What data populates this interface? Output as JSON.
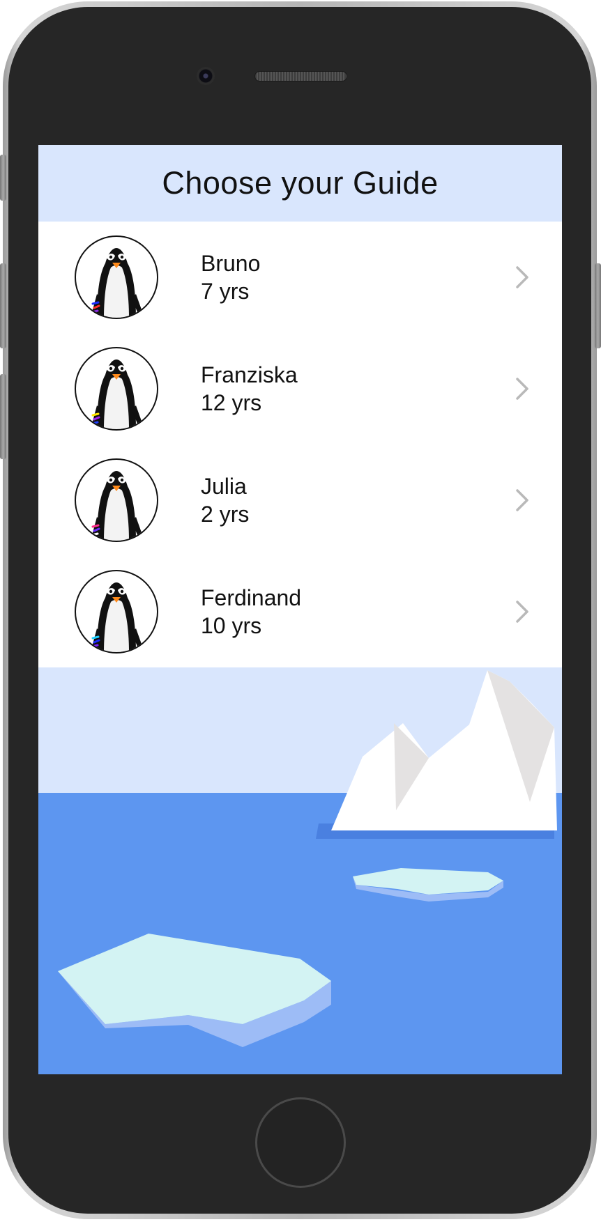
{
  "header": {
    "title": "Choose your Guide"
  },
  "guides": [
    {
      "name": "Bruno",
      "age": "7 yrs",
      "scarf_colors": [
        "#1a2bff",
        "#ff2a2a",
        "#8a2be2"
      ]
    },
    {
      "name": "Franziska",
      "age": "12 yrs",
      "scarf_colors": [
        "#ffe600",
        "#a020f0",
        "#2040ff"
      ]
    },
    {
      "name": "Julia",
      "age": "2 yrs",
      "scarf_colors": [
        "#ff2d8a",
        "#6a2bff",
        "#ffffff"
      ]
    },
    {
      "name": "Ferdinand",
      "age": "10 yrs",
      "scarf_colors": [
        "#1fd0ff",
        "#1a2bff",
        "#7a20ff"
      ]
    }
  ],
  "icons": {
    "row_action": "chevron-right-icon",
    "avatar": "penguin-icon"
  },
  "colors": {
    "header_bg": "#d9e6fd",
    "sky": "#d9e6fd",
    "sea": "#5d96f0",
    "ice_top": "#d3f3f3",
    "ice_side": "#9dbcf6",
    "iceberg": "#ffffff",
    "iceberg_shadow": "#e4e2e2",
    "chevron": "#b9b9b9"
  }
}
